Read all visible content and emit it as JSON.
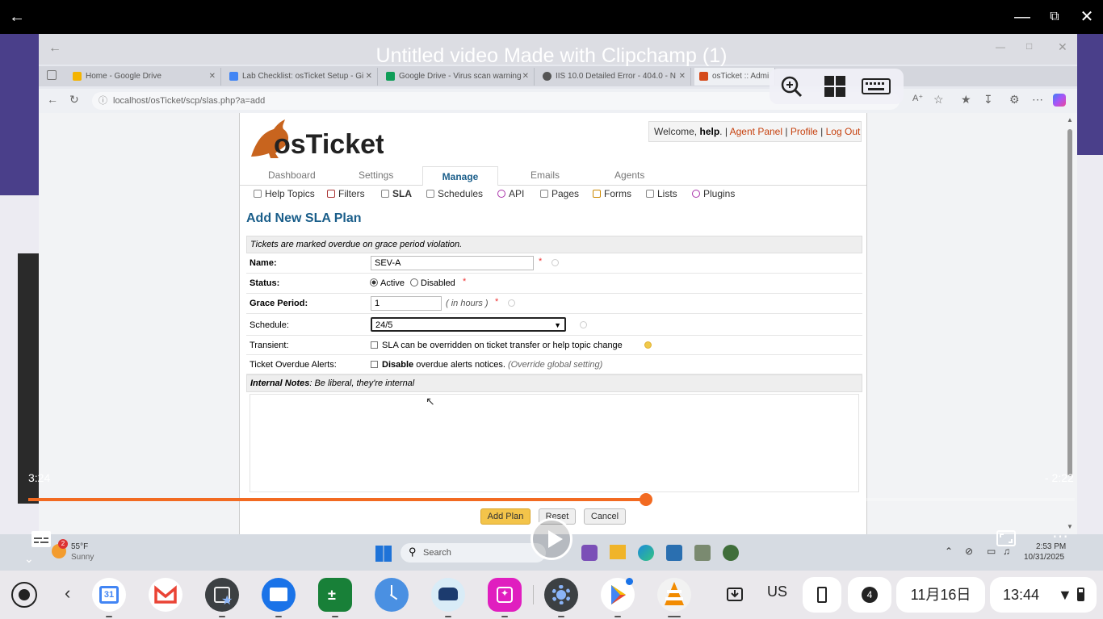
{
  "video_window": {
    "title": "Untitled video Made with Clipchamp (1)",
    "elapsed": "3:24",
    "remaining": "- 2:22",
    "progress": 0.59,
    "colors": {
      "accent": "#f26a21"
    }
  },
  "browser": {
    "tabs": [
      {
        "label": "Home - Google Drive",
        "fav": "#f4b400"
      },
      {
        "label": "Lab Checklist: osTicket Setup - Gi",
        "fav": "#4285f4"
      },
      {
        "label": "Google Drive - Virus scan warning",
        "fav": "#0f9d58"
      },
      {
        "label": "IIS 10.0 Detailed Error - 404.0 - N",
        "fav": "#555555"
      },
      {
        "label": "osTicket :: Admi",
        "fav": "#d54a1a"
      }
    ],
    "tab_close": "✕",
    "address": "localhost/osTicket/scp/slas.php?a=add"
  },
  "osticket": {
    "welcome_prefix": "Welcome,",
    "user": "help",
    "sep": ".",
    "agent_panel": "Agent Panel",
    "profile": "Profile",
    "logout": "Log Out",
    "main_nav": [
      "Dashboard",
      "Settings",
      "Manage",
      "Emails",
      "Agents"
    ],
    "sub_nav": [
      "Help Topics",
      "Filters",
      "SLA",
      "Schedules",
      "API",
      "Pages",
      "Forms",
      "Lists",
      "Plugins"
    ],
    "page_title": "Add New SLA Plan",
    "notice": "Tickets are marked overdue on grace period violation.",
    "fields": {
      "name_label": "Name:",
      "name_value": "SEV-A",
      "status_label": "Status:",
      "status_active": "Active",
      "status_disabled": "Disabled",
      "grace_label": "Grace Period:",
      "grace_value": "1",
      "grace_unit": "( in hours )",
      "schedule_label": "Schedule:",
      "schedule_value": "24/5",
      "transient_label": "Transient:",
      "transient_text": "SLA can be overridden on ticket transfer or help topic change",
      "alerts_label": "Ticket Overdue Alerts:",
      "alerts_bold": "Disable",
      "alerts_text": "overdue alerts notices.",
      "alerts_note": "(Override global setting)",
      "required_mark": "*"
    },
    "notes_label": "Internal Notes",
    "notes_hint": ": Be liberal, they're internal",
    "buttons": {
      "add": "Add Plan",
      "reset": "Reset",
      "cancel": "Cancel"
    }
  },
  "recorded_taskbar": {
    "weather_temp": "55°F",
    "weather_desc": "Sunny",
    "weather_badge": "2",
    "search": "Search",
    "clock_time": "2:53 PM",
    "clock_date": "10/31/2025"
  },
  "shelf": {
    "keyboard_layout": "US",
    "notifications": "4",
    "date": "11月16日",
    "time": "13:44"
  }
}
